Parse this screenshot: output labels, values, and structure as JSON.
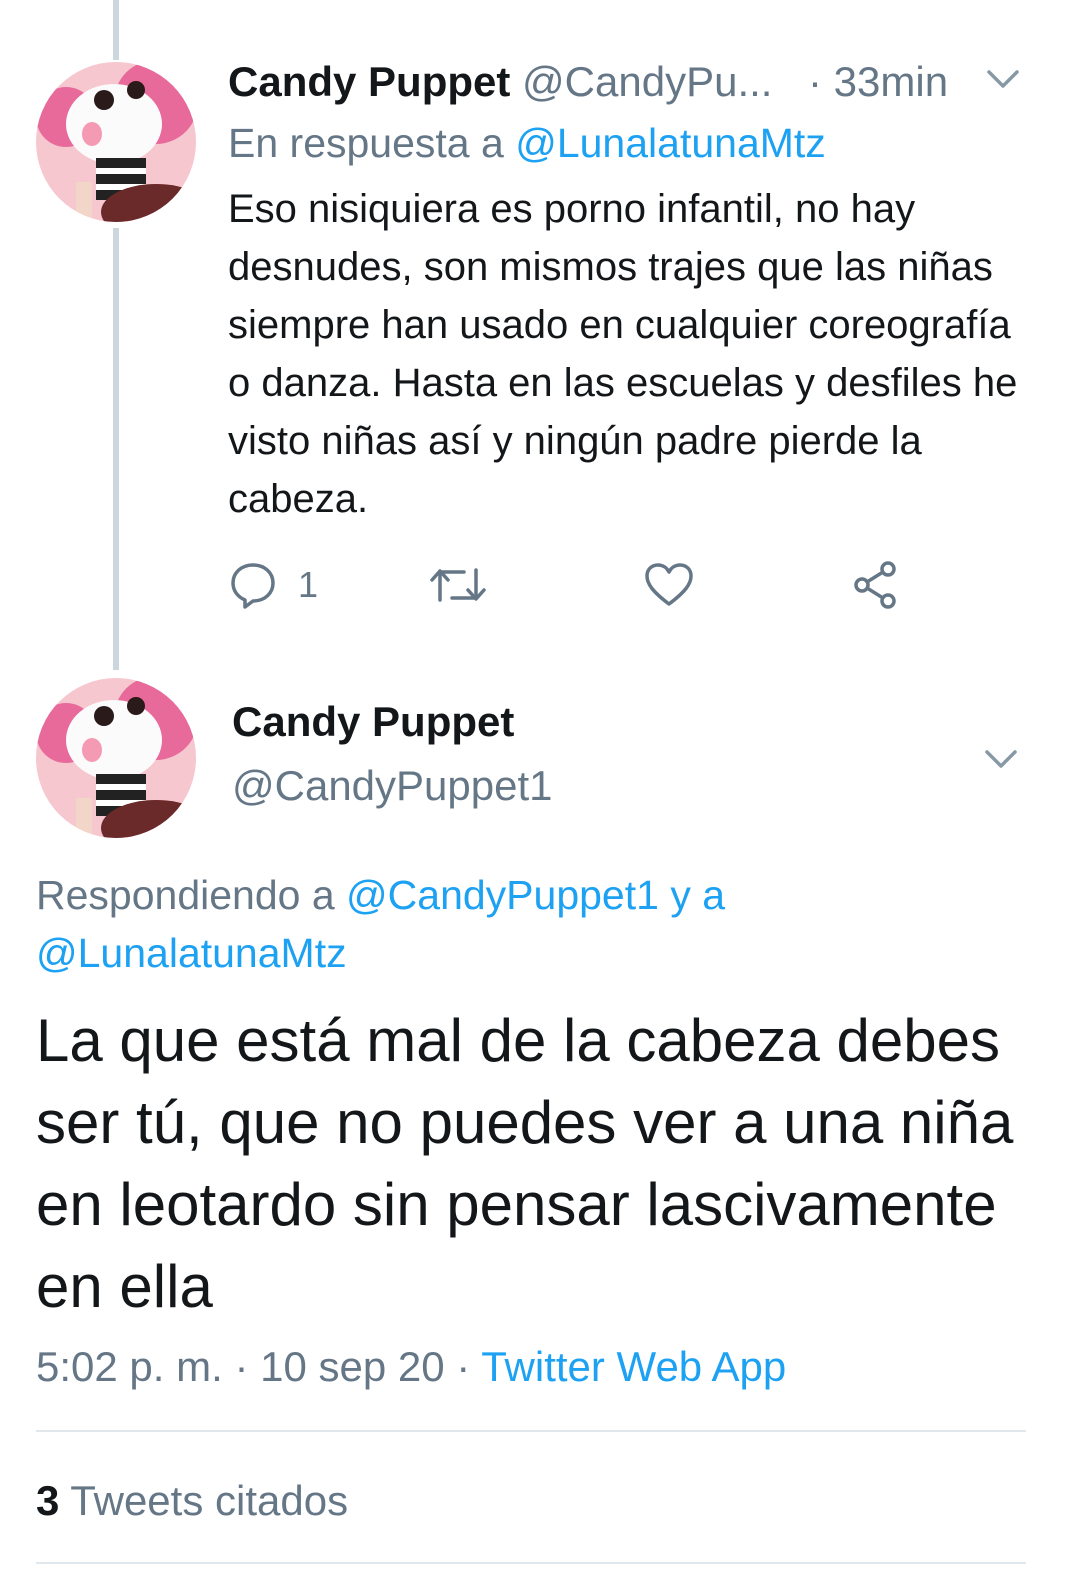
{
  "tweet1": {
    "display_name": "Candy Puppet",
    "handle": "@CandyPu...",
    "separator": "·",
    "time": "33min",
    "reply_prefix": "En respuesta a",
    "reply_to": "@LunalatunaMtz",
    "text": "Eso nisiquiera es porno infantil, no hay desnudes, son mismos trajes que las niñas siempre han usado en cualquier coreografía o danza. Hasta en las escuelas y desfiles he visto niñas así y ningún padre pierde la cabeza.",
    "reply_count": "1",
    "icons": [
      "reply-icon",
      "retweet-icon",
      "like-icon",
      "share-icon",
      "chevron-down-icon"
    ]
  },
  "tweet2": {
    "display_name": "Candy Puppet",
    "handle": "@CandyPuppet1",
    "replying_prefix": "Respondiendo a",
    "replying_to": "@CandyPuppet1 y a @LunalatunaMtz",
    "text": "La que está mal de la cabeza debes ser tú, que no puedes ver a una niña en leotardo sin pensar lascivamente en ella",
    "time": "5:02 p. m.",
    "date": "10 sep 20",
    "source": "Twitter Web App",
    "separator": "·"
  },
  "quoted": {
    "count": "3",
    "label": "Tweets citados"
  },
  "colors": {
    "link": "#1da1f2",
    "muted": "#657786",
    "text": "#14171a",
    "thread_line": "#ccd6dd"
  }
}
